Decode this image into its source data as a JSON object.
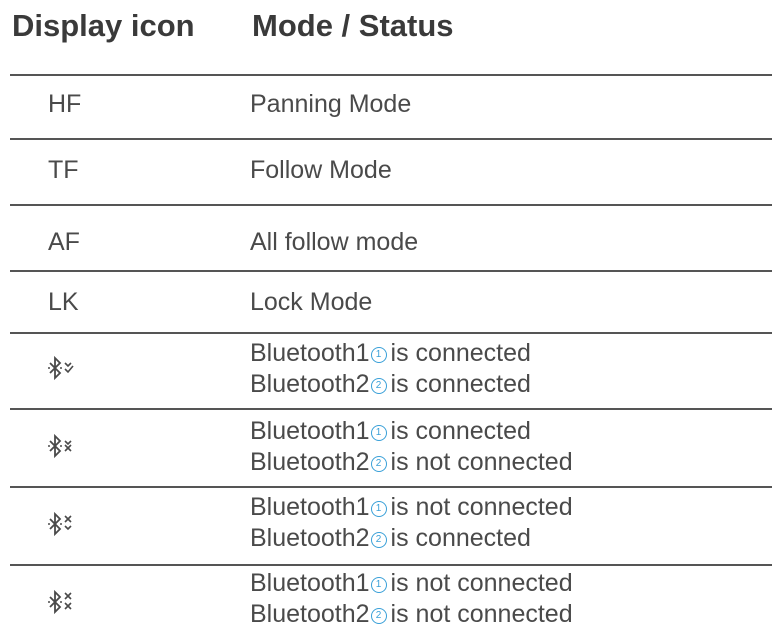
{
  "header": {
    "col_icon": "Display icon",
    "col_mode": "Mode / Status"
  },
  "rows_simple": [
    {
      "icon": "HF",
      "status": "Panning Mode"
    },
    {
      "icon": "TF",
      "status": "Follow Mode"
    },
    {
      "icon": "AF",
      "status": "All follow mode"
    },
    {
      "icon": "LK",
      "status": "Lock Mode"
    }
  ],
  "rows_bt": [
    {
      "icon": "bluetooth-both-connected-icon",
      "line1": {
        "device": "Bluetooth1",
        "badge": "1",
        "state": "is connected"
      },
      "line2": {
        "device": "Bluetooth2",
        "badge": "2",
        "state": "is connected"
      }
    },
    {
      "icon": "bluetooth-one-connected-icon",
      "line1": {
        "device": "Bluetooth1",
        "badge": "1",
        "state": "is connected"
      },
      "line2": {
        "device": "Bluetooth2",
        "badge": "2",
        "state": "is not connected"
      }
    },
    {
      "icon": "bluetooth-two-connected-icon",
      "line1": {
        "device": "Bluetooth1",
        "badge": "1",
        "state": "is not connected"
      },
      "line2": {
        "device": "Bluetooth2",
        "badge": "2",
        "state": "is connected"
      }
    },
    {
      "icon": "bluetooth-none-connected-icon",
      "line1": {
        "device": "Bluetooth1",
        "badge": "1",
        "state": "is not connected"
      },
      "line2": {
        "device": "Bluetooth2",
        "badge": "2",
        "state": "is not connected"
      }
    }
  ],
  "colors": {
    "text": "#4a4a4a",
    "badge": "#3aa0d8",
    "rule": "#555555"
  }
}
